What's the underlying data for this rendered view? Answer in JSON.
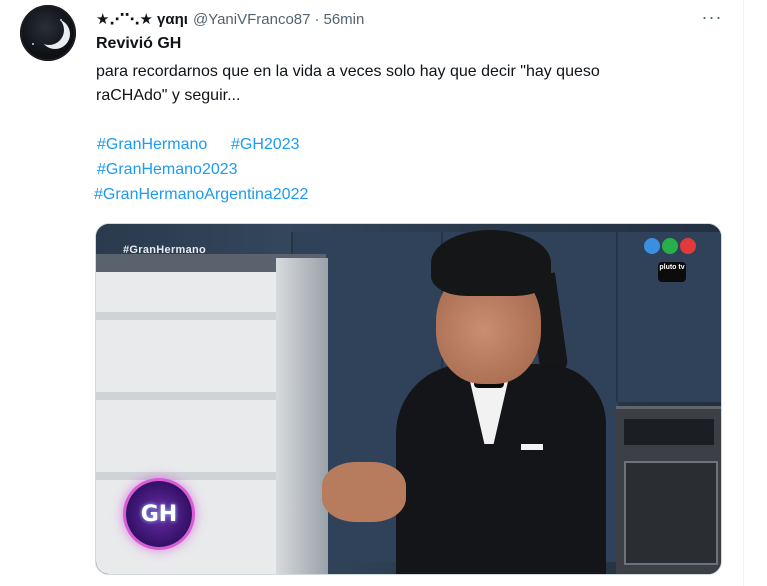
{
  "tweet": {
    "display_name": "★⋰⋱★ γαηι",
    "handle": "@YaniVFranco87",
    "separator": "·",
    "time": "56min",
    "more_label": "···",
    "title": "Revivió GH",
    "body_lines": [
      "para recordarnos que en la vida a veces solo hay que decir \"hay queso",
      "raCHAdo\" y seguir..."
    ],
    "hashtags": [
      "#GranHermano",
      "#GH2023",
      "#GranHemano2023",
      "#GranHermanoArgentina2022"
    ]
  },
  "media": {
    "watermark": "#GranHermano",
    "channel_dot_colors": [
      "#3b8fe0",
      "#27b04a",
      "#e23a3a"
    ],
    "pluto_label": "pluto tv",
    "gh_logo_text": "GH",
    "gh_logo_glow": "#d95bd8"
  }
}
